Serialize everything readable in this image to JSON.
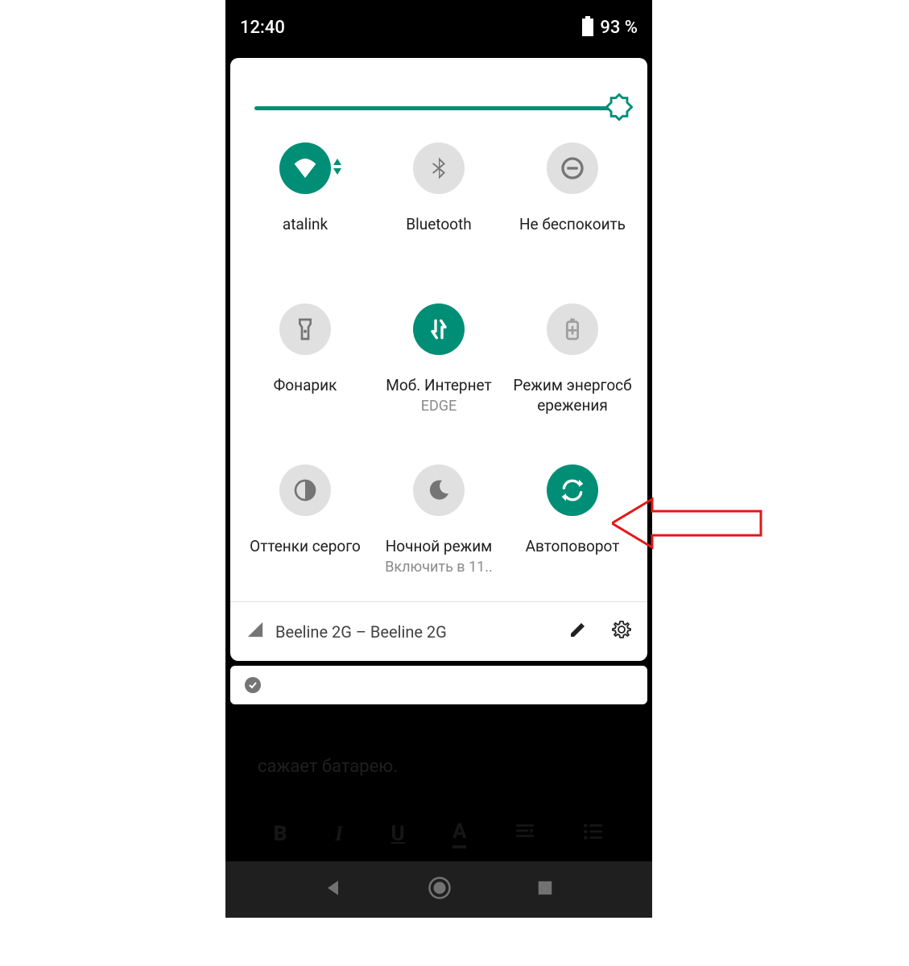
{
  "statusbar": {
    "time": "12:40",
    "battery_percent": "93 %"
  },
  "brightness": {
    "percent": 96
  },
  "tiles": [
    {
      "id": "wifi",
      "label": "atalink",
      "sublabel": "",
      "active": true
    },
    {
      "id": "bluetooth",
      "label": "Bluetooth",
      "sublabel": "",
      "active": false
    },
    {
      "id": "dnd",
      "label": "Не беспокоить",
      "sublabel": "",
      "active": false
    },
    {
      "id": "flashlight",
      "label": "Фонарик",
      "sublabel": "",
      "active": false
    },
    {
      "id": "mobiledata",
      "label": "Моб. Интернет",
      "sublabel": "EDGE",
      "active": true
    },
    {
      "id": "battery-saver",
      "label": "Режим энергосб\nережения",
      "sublabel": "",
      "active": false
    },
    {
      "id": "grayscale",
      "label": "Оттенки серого",
      "sublabel": "",
      "active": false
    },
    {
      "id": "night-mode",
      "label": "Ночной режим",
      "sublabel": "Включить в 11..",
      "active": false
    },
    {
      "id": "autorotate",
      "label": "Автоповорот",
      "sublabel": "",
      "active": true
    }
  ],
  "footer": {
    "carrier": "Beeline 2G – Beeline 2G"
  },
  "background": {
    "text_fragment": "сажает батарею."
  },
  "colors": {
    "accent": "#008e76",
    "tile_inactive": "#e0e0e0"
  }
}
